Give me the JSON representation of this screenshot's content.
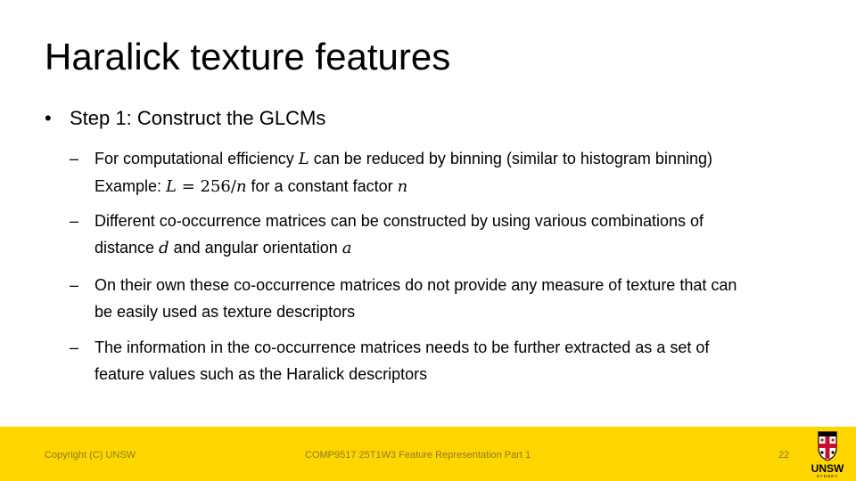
{
  "slide": {
    "title": "Haralick texture features",
    "bullet": {
      "marker": "•",
      "text": "Step 1: Construct the GLCMs"
    },
    "dash": "–",
    "sub1": {
      "a": "For computational efficiency ",
      "var": "L",
      "b": " can be reduced by binning (similar to histogram binning)",
      "c": "Example: ",
      "eq1": "L",
      "eq2": " = 256/",
      "eq3": "n",
      "d": " for a constant factor ",
      "e": "n"
    },
    "sub2": {
      "a": "Different co-occurrence matrices can be constructed by using various combinations of",
      "b": "distance ",
      "v1": "d",
      "c": " and angular orientation ",
      "v2": "a"
    },
    "sub3": {
      "a": "On their own these co-occurrence matrices do not provide any measure of texture that can",
      "b": "be easily used as texture descriptors"
    },
    "sub4": {
      "a": "The information in the co-occurrence matrices needs to be further extracted as a set of",
      "b": "feature values such as the Haralick descriptors"
    }
  },
  "footer": {
    "copyright": "Copyright (C) UNSW",
    "course": "COMP9517 25T1W3 Feature Representation Part 1",
    "page": "22",
    "logo_text": "UNSW",
    "logo_sub": "SYDNEY"
  },
  "colors": {
    "footer_bg": "#FFD600",
    "footer_text": "#8a7a22",
    "crest_red": "#C8102E"
  }
}
